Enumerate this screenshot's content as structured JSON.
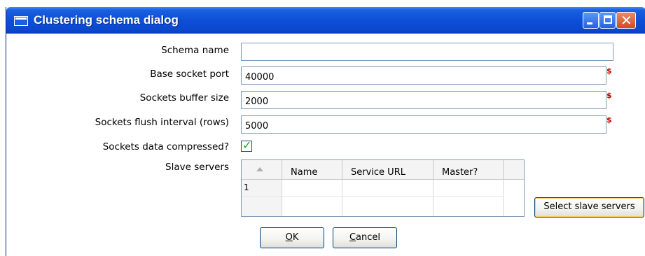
{
  "window": {
    "title": "Clustering schema dialog",
    "close_glyph": "✕"
  },
  "form": {
    "schema_name": {
      "label": "Schema name",
      "value": ""
    },
    "base_socket_port": {
      "label": "Base socket port",
      "value": "40000"
    },
    "sockets_buffer_size": {
      "label": "Sockets buffer size",
      "value": "2000"
    },
    "sockets_flush_interval": {
      "label": "Sockets flush interval (rows)",
      "value": "5000"
    },
    "sockets_compressed": {
      "label": "Sockets data compressed?",
      "checked": true,
      "check_glyph": "✓"
    },
    "slave_servers_label": "Slave servers",
    "variable_icon_glyph": "$"
  },
  "slave_table": {
    "columns": [
      "Name",
      "Service URL",
      "Master?"
    ],
    "rows": [
      {
        "index": "1",
        "name": "",
        "service_url": "",
        "master": ""
      }
    ]
  },
  "buttons": {
    "select_slave_servers": "Select slave servers",
    "ok_mnemonic": "O",
    "ok_rest": "K",
    "cancel_mnemonic": "C",
    "cancel_rest": "ancel"
  },
  "colors": {
    "titlebar": "#0b48cf",
    "variable_icon": "#c00000",
    "checkmark": "#21a121"
  }
}
